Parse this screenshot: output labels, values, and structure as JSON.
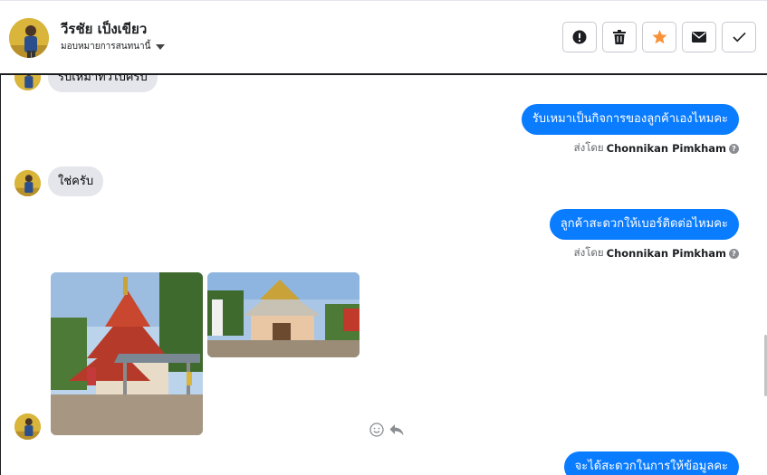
{
  "header": {
    "contact_name": "วีรชัย เป็งเขียว",
    "assign_label": "มอบหมายการสนทนานี้",
    "actions": [
      {
        "name": "report-spam-button",
        "icon": "exclamation-circle-icon",
        "color": "#1c1e21"
      },
      {
        "name": "delete-button",
        "icon": "trash-icon",
        "color": "#1c1e21"
      },
      {
        "name": "star-button",
        "icon": "star-icon",
        "color": "#f7923a"
      },
      {
        "name": "mark-unread-button",
        "icon": "envelope-icon",
        "color": "#1c1e21"
      },
      {
        "name": "mark-done-button",
        "icon": "checkmark-icon",
        "color": "#1c1e21"
      }
    ]
  },
  "messages": {
    "m0": {
      "text": "รับเหมาทั่วไปครับ",
      "direction": "incoming"
    },
    "m1": {
      "text": "รับเหมาเป็นกิจการของลูกค้าเองไหมคะ",
      "direction": "outgoing",
      "sent_by_prefix": "ส่งโดย",
      "sent_by_name": "Chonnikan Pimkham"
    },
    "m2": {
      "text": "ใช่ครับ",
      "direction": "incoming"
    },
    "m3": {
      "text": "ลูกค้าสะดวกให้เบอร์ติดต่อไหมคะ",
      "direction": "outgoing",
      "sent_by_prefix": "ส่งโดย",
      "sent_by_name": "Chonnikan Pimkham"
    },
    "m4": {
      "direction": "incoming",
      "attachments": [
        "temple-building-photo",
        "small-building-photo"
      ]
    },
    "m5": {
      "text": "จะได้สะดวกในการให้ข้อมูลคะ",
      "direction": "outgoing"
    }
  },
  "colors": {
    "outgoing_bubble": "#0a7cff",
    "incoming_bubble": "#e4e6eb",
    "star": "#f7923a"
  }
}
